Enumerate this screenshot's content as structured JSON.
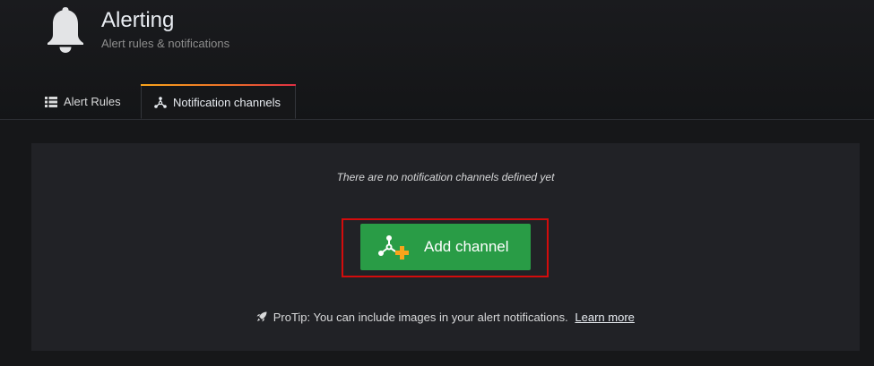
{
  "header": {
    "title": "Alerting",
    "subtitle": "Alert rules & notifications",
    "icon": "bell-icon"
  },
  "tabs": [
    {
      "label": "Alert Rules",
      "icon": "list-icon",
      "active": false
    },
    {
      "label": "Notification channels",
      "icon": "channels-icon",
      "active": true
    }
  ],
  "empty_state": {
    "message": "There are no notification channels defined yet",
    "add_button_label": "Add channel",
    "add_button_icon": "add-channel-icon",
    "protip_icon": "rocket-icon",
    "protip_text": "ProTip: You can include images in your alert notifications.",
    "learn_more_label": "Learn more"
  },
  "colors": {
    "background": "#161719",
    "panel": "#212226",
    "button": "#299c46",
    "highlight": "#d40c0c",
    "tab_accent": "#f9a41b"
  }
}
